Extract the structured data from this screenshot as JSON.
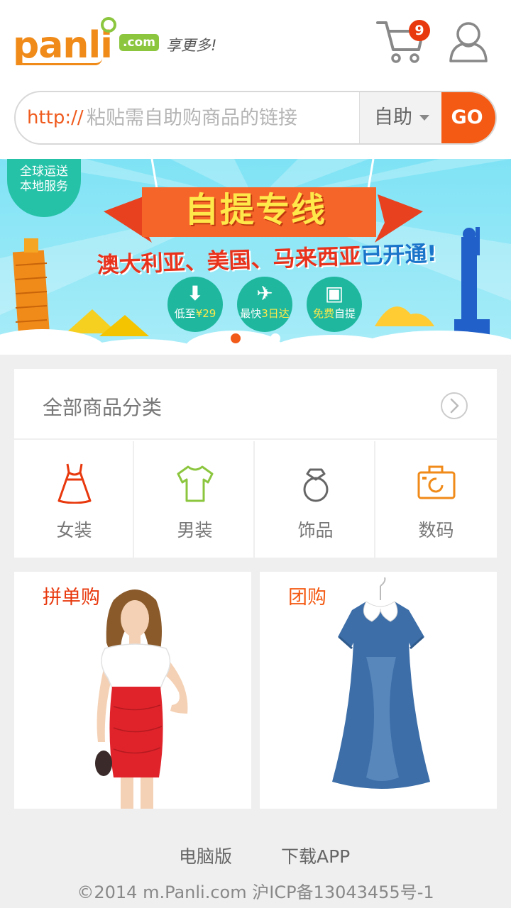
{
  "header": {
    "logo_text": "panli",
    "logo_domain": ".com",
    "slogan": "享更多!",
    "cart_count": "9"
  },
  "search": {
    "prefix": "http://",
    "placeholder": "粘贴需自助购商品的链接",
    "mode": "自助",
    "go_label": "GO"
  },
  "banner": {
    "badge_line1": "全球运送",
    "badge_line2": "本地服务",
    "title": "自提专线",
    "subtitle_part1": "澳大利亚、美国、马来西亚",
    "subtitle_part2": "已开通!",
    "features": [
      {
        "icon": "arrow-down-icon",
        "label_plain": "低至",
        "label_hl": "¥29"
      },
      {
        "icon": "plane-icon",
        "label_plain": "最快",
        "label_hl": "3日达"
      },
      {
        "icon": "box-icon",
        "label_plain": "免费",
        "label_hl": "自提"
      }
    ],
    "active_slide": 1,
    "slide_count": 3
  },
  "categories": {
    "heading": "全部商品分类",
    "items": [
      {
        "label": "女装",
        "icon": "dress-icon",
        "color": "#e8380d"
      },
      {
        "label": "男装",
        "icon": "tshirt-icon",
        "color": "#8cc63f"
      },
      {
        "label": "饰品",
        "icon": "ring-icon",
        "color": "#666666"
      },
      {
        "label": "数码",
        "icon": "camera-icon",
        "color": "#f08a18"
      }
    ]
  },
  "promos": [
    {
      "title": "拼单购",
      "color": "#e8380d"
    },
    {
      "title": "团购",
      "color": "#f45a13"
    }
  ],
  "footer": {
    "link_desktop": "电脑版",
    "link_app": "下载APP",
    "copyright": "©2014 m.Panli.com  沪ICP备13043455号-1"
  }
}
